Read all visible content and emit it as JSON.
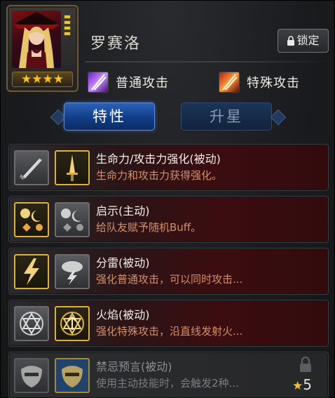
{
  "hero": {
    "name": "罗赛洛",
    "stars": "★★★★",
    "lock_label": "锁定"
  },
  "attacks": {
    "normal": "普通攻击",
    "special": "特殊攻击"
  },
  "tabs": {
    "traits": "特性",
    "star_up": "升星"
  },
  "traits": [
    {
      "title": "生命力/攻击力强化(被动)",
      "desc": "生命力和攻击力获得强化。",
      "icon1": "sword-icon",
      "icon2": "blade-icon",
      "locked": false
    },
    {
      "title": "启示(主动)",
      "desc": "给队友赋予随机Buff。",
      "icon1": "moon-sun-icon",
      "icon2": "moon-sun-icon",
      "locked": false
    },
    {
      "title": "分雷(被动)",
      "desc": "强化普通攻击，可以同时攻击...",
      "icon1": "lightning-icon",
      "icon2": "thundercloud-icon",
      "locked": false
    },
    {
      "title": "火焰(被动)",
      "desc": "强化特殊攻击，沿直线发射火...",
      "icon1": "hexagram-icon",
      "icon2": "hexagram-icon",
      "locked": false
    },
    {
      "title": "禁忌预言(被动)",
      "desc": "使用主动技能时，会触发2种...",
      "icon1": "mask-icon",
      "icon2": "mask-icon",
      "locked": true,
      "requirement_star": "★",
      "requirement_value": "5"
    }
  ],
  "colors": {
    "desc_text": "#d38e6a",
    "active_tab": "#1e4f9e",
    "gold_border": "#d7b143",
    "star": "#f4c02c"
  }
}
